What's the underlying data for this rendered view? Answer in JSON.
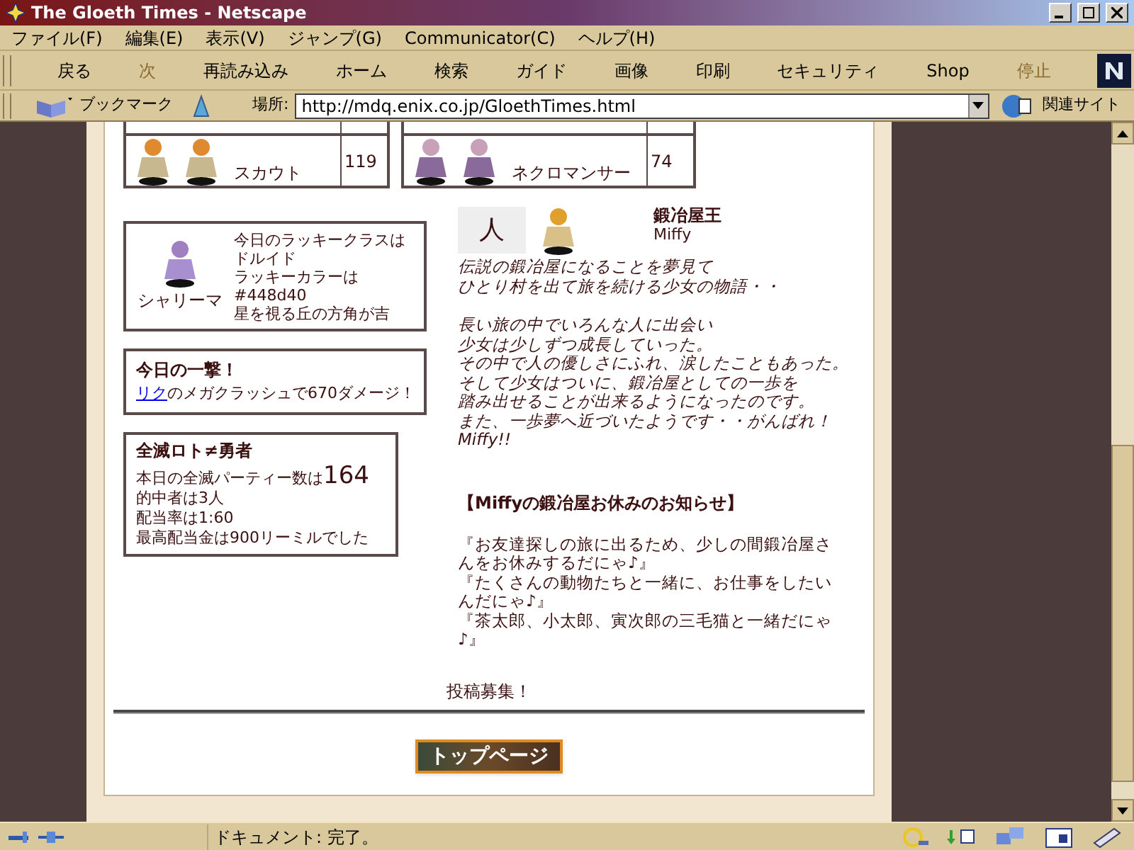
{
  "window": {
    "title": "The Gloeth Times - Netscape"
  },
  "menu": [
    "ファイル(F)",
    "編集(E)",
    "表示(V)",
    "ジャンプ(G)",
    "Communicator(C)",
    "ヘルプ(H)"
  ],
  "toolbar": [
    {
      "label": "戻る",
      "disabled": false
    },
    {
      "label": "次",
      "disabled": true
    },
    {
      "label": "再読み込み",
      "disabled": false
    },
    {
      "label": "ホーム",
      "disabled": false
    },
    {
      "label": "検索",
      "disabled": false
    },
    {
      "label": "ガイド",
      "disabled": false
    },
    {
      "label": "画像",
      "disabled": false
    },
    {
      "label": "印刷",
      "disabled": false
    },
    {
      "label": "セキュリティ",
      "disabled": false
    },
    {
      "label": "Shop",
      "disabled": false
    },
    {
      "label": "停止",
      "disabled": true
    }
  ],
  "location": {
    "bookmarks": "ブックマーク",
    "label": "場所:",
    "url": "http://mdq.enix.co.jp/GloethTimes.html",
    "related": "関連サイト"
  },
  "class_tables": [
    {
      "name": "スカウト",
      "count": "119"
    },
    {
      "name": "ネクロマンサー",
      "count": "74"
    }
  ],
  "lucky": {
    "character": "シャリーマ",
    "lines": [
      "今日のラッキークラスはドルイド",
      "ラッキーカラーは#448d40",
      "星を視る丘の方角が吉"
    ]
  },
  "strike": {
    "title": "今日の一撃！",
    "link": "リク",
    "text": "のメガクラッシュで670ダメージ！"
  },
  "lotto": {
    "title": "全滅ロト≠勇者",
    "count_label": "本日の全滅パーティー数は",
    "count": "164",
    "lines": [
      "的中者は3人",
      "配当率は1:60",
      "最高配当金は900リーミルでした"
    ]
  },
  "story": {
    "kanji": "人",
    "title": "鍛冶屋王",
    "author": "Miffy",
    "paragraphs": [
      [
        "伝説の鍛冶屋になることを夢見て",
        "ひとり村を出て旅を続ける少女の物語・・"
      ],
      [
        "長い旅の中でいろんな人に出会い",
        "少女は少しずつ成長していった。",
        "その中で人の優しさにふれ、涙したこともあった。",
        "そして少女はついに、鍛冶屋としての一歩を",
        "踏み出せることが出来るようになったのです。",
        "また、一歩夢へ近づいたようです・・がんばれ！",
        "Miffy!!"
      ]
    ]
  },
  "notice": {
    "title": "【Miffyの鍛冶屋お休みのお知らせ】",
    "lines": [
      "『お友達探しの旅に出るため、少しの間鍛冶屋さんをお休みするだにゃ♪』",
      "『たくさんの動物たちと一緒に、お仕事をしたいんだにゃ♪』",
      "『茶太郎、小太郎、寅次郎の三毛猫と一緒だにゃ♪』"
    ]
  },
  "footer": {
    "text": "投稿募集！",
    "button": "トップページ"
  },
  "status_bar": {
    "text": "ドキュメント: 完了。"
  }
}
